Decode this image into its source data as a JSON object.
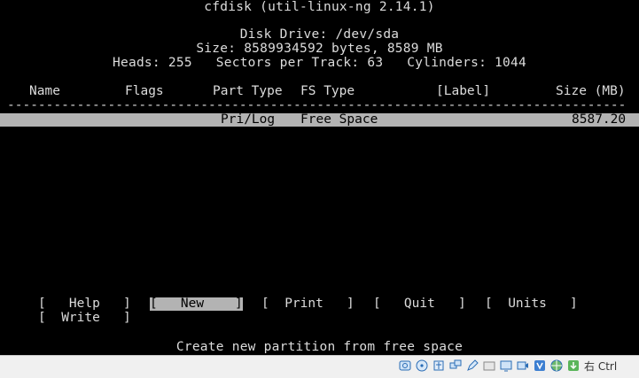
{
  "app": {
    "title": "cfdisk (util-linux-ng 2.14.1)"
  },
  "disk": {
    "drive_line": "Disk Drive: /dev/sda",
    "size_line": "Size: 8589934592 bytes, 8589 MB",
    "geometry_line": "Heads: 255   Sectors per Track: 63   Cylinders: 1044"
  },
  "table": {
    "columns": {
      "name": "Name",
      "flags": "Flags",
      "part_type": "Part Type",
      "fs_type": "FS Type",
      "label": "[Label]",
      "size": "Size (MB)"
    },
    "separator": "-----------------------------------------------------------------------------------------------------------------------",
    "rows": [
      {
        "name": "",
        "flags": "",
        "part_type": "Pri/Log",
        "fs_type": "Free Space",
        "label": "",
        "size": "8587.20",
        "selected": true
      }
    ]
  },
  "menu": {
    "help": "[   Help   ]",
    "new": "[   New    ]",
    "print": "[  Print   ]",
    "quit": "[   Quit   ]",
    "units": "[  Units   ]",
    "write": "[  Write   ]",
    "selected": "new"
  },
  "status": {
    "hint": "Create new partition from free space"
  },
  "vbox_statusbar": {
    "icons": [
      "hard-disk-icon",
      "optical-disk-icon",
      "usb-icon",
      "network-icon",
      "pencil-icon",
      "shared-folder-icon",
      "display-icon",
      "video-capture-icon",
      "virtualization-icon",
      "network-globe-icon",
      "arrow-down-icon"
    ],
    "host_key": "右 Ctrl"
  },
  "colors": {
    "background": "#000000",
    "text": "#dcdcdc",
    "highlight": "#b3b3b3",
    "statusbar": "#f0f0f0"
  }
}
